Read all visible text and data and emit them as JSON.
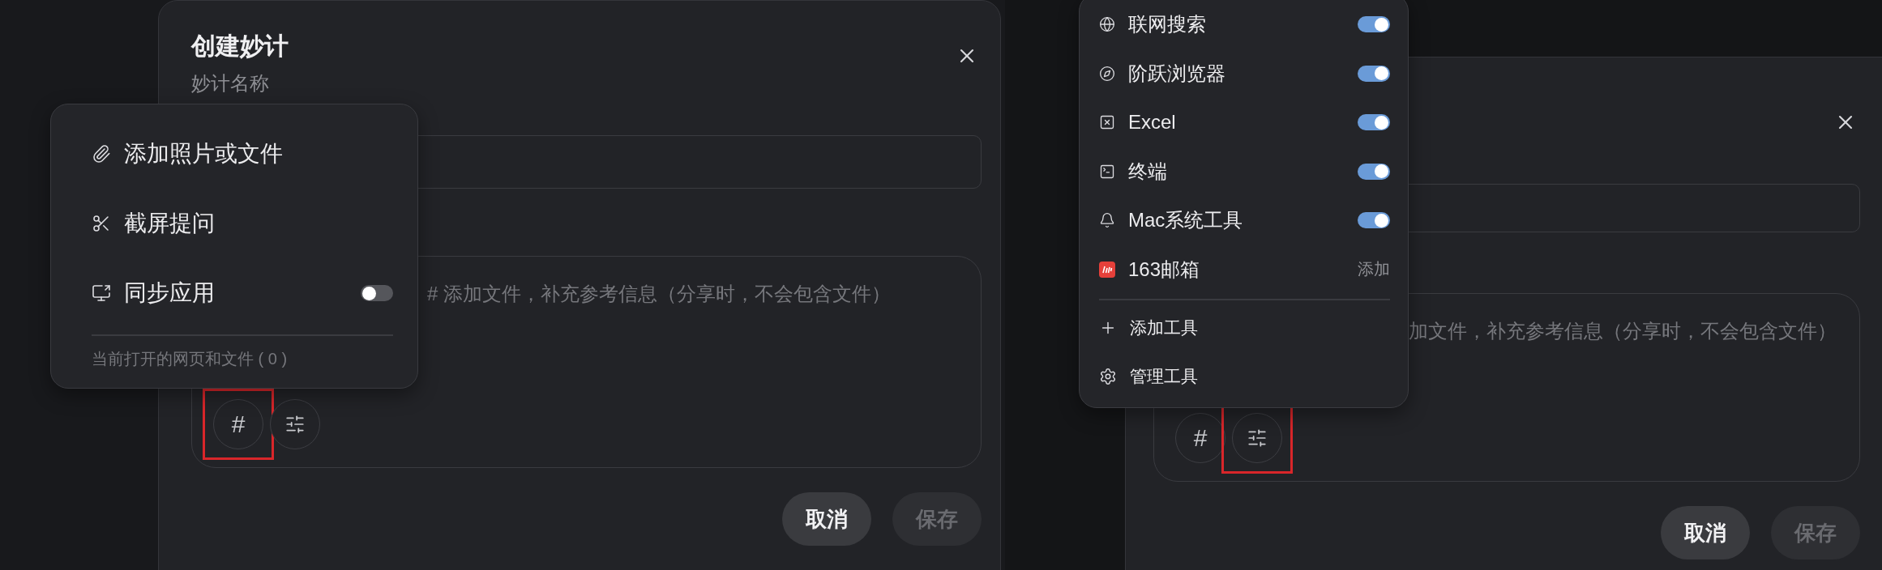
{
  "panels": [
    {
      "dialog": {
        "title": "创建妙计",
        "field_label": "妙计名称",
        "note_placeholder": "# 添加文件，补充参考信息（分享时，不会包含文件）",
        "tool_buttons": [
          {
            "kind": "hash",
            "label": "#",
            "highlighted": true
          },
          {
            "kind": "sliders",
            "highlighted": false
          }
        ],
        "buttons": [
          {
            "label": "取消",
            "disabled": false
          },
          {
            "label": "保存",
            "disabled": true
          }
        ]
      },
      "popup": {
        "kind": "attach",
        "items": [
          {
            "kind": "action",
            "label": "添加照片或文件"
          },
          {
            "kind": "action",
            "label": "截屏提问"
          },
          {
            "kind": "toggle",
            "label": "同步应用",
            "on": false
          }
        ],
        "footer": "当前打开的网页和文件 ( 0 )"
      }
    },
    {
      "dialog": {
        "note_placeholder": "加文件，补充参考信息（分享时，不会包含文件）",
        "tool_buttons": [
          {
            "kind": "hash",
            "label": "#",
            "highlighted": false
          },
          {
            "kind": "sliders",
            "highlighted": true
          }
        ],
        "buttons": [
          {
            "label": "取消",
            "disabled": false
          },
          {
            "label": "保存",
            "disabled": true
          }
        ]
      },
      "popup": {
        "kind": "tools",
        "items": [
          {
            "kind": "toggle",
            "label": "联网搜索",
            "on": true
          },
          {
            "kind": "toggle",
            "label": "阶跃浏览器",
            "on": true
          },
          {
            "kind": "toggle",
            "label": "Excel",
            "on": true
          },
          {
            "kind": "toggle",
            "label": "终端",
            "on": true
          },
          {
            "kind": "toggle",
            "label": "Mac系统工具",
            "on": true
          },
          {
            "kind": "addable",
            "label": "163邮箱",
            "action": "添加"
          }
        ],
        "links": [
          {
            "label": "添加工具"
          },
          {
            "label": "管理工具"
          }
        ]
      }
    }
  ]
}
